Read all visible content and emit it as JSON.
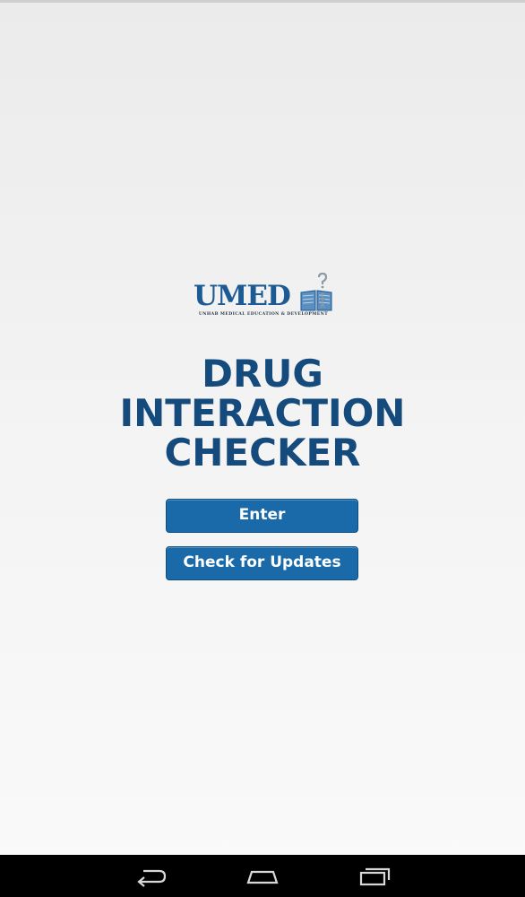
{
  "logo": {
    "text": "UMED",
    "tagline": "UNHAB MEDICAL EDUCATION & DEVELOPMENT",
    "icon": "book-question-icon"
  },
  "title": {
    "line1": "DRUG",
    "line2": "INTERACTION",
    "line3": "CHECKER"
  },
  "buttons": {
    "enter_label": "Enter",
    "updates_label": "Check for Updates"
  },
  "navbar": {
    "back_icon": "back-icon",
    "home_icon": "home-icon",
    "recents_icon": "recents-icon"
  },
  "colors": {
    "brand": "#154a7d",
    "button": "#1a6aaa",
    "background": "#f0f0f0",
    "navbar": "#000000"
  }
}
